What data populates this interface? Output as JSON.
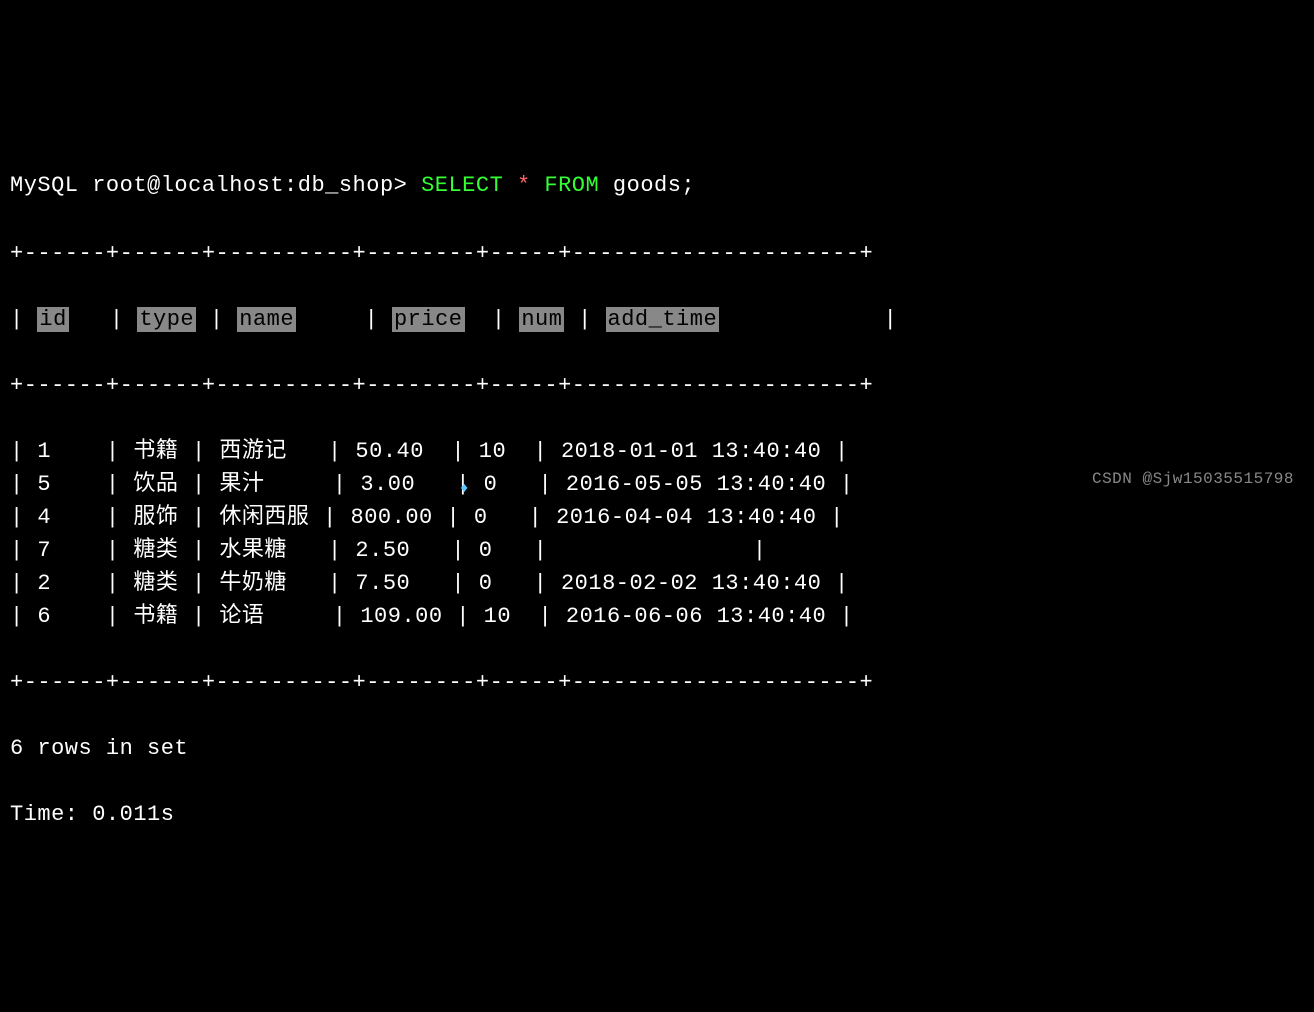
{
  "truncated_top": "",
  "prompt": {
    "user": "MySQL root@localhost:db_shop>",
    "query_select": "SELECT",
    "query_star": "*",
    "query_from": "FROM",
    "query_table": "goods;"
  },
  "border_top": "+------+------+----------+--------+-----+---------------------+",
  "headers": {
    "pipe": "|",
    "id": "id",
    "type": "type",
    "name": "name",
    "price": "price",
    "num": "num",
    "add_time": "add_time"
  },
  "border_mid": "+------+------+----------+--------+-----+---------------------+",
  "rows": [
    {
      "id": "1",
      "type": "书籍",
      "name": "西游记",
      "price": "50.40",
      "num": "10",
      "add_time": "2018-01-01 13:40:40"
    },
    {
      "id": "5",
      "type": "饮品",
      "name": "果汁",
      "price": "3.00",
      "num": "0",
      "add_time": "2016-05-05 13:40:40"
    },
    {
      "id": "4",
      "type": "服饰",
      "name": "休闲西服",
      "price": "800.00",
      "num": "0",
      "add_time": "2016-04-04 13:40:40"
    },
    {
      "id": "7",
      "type": "糖类",
      "name": "水果糖",
      "price": "2.50",
      "num": "0",
      "add_time": "<null>"
    },
    {
      "id": "2",
      "type": "糖类",
      "name": "牛奶糖",
      "price": "7.50",
      "num": "0",
      "add_time": "2018-02-02 13:40:40"
    },
    {
      "id": "6",
      "type": "书籍",
      "name": "论语",
      "price": "109.00",
      "num": "10",
      "add_time": "2016-06-06 13:40:40"
    }
  ],
  "border_bot": "+------+------+----------+--------+-----+---------------------+",
  "result_rows": "6 rows in set",
  "result_time": "Time: 0.011s",
  "next_prompt": "",
  "watermark": "CSDN @Sjw15035515798"
}
